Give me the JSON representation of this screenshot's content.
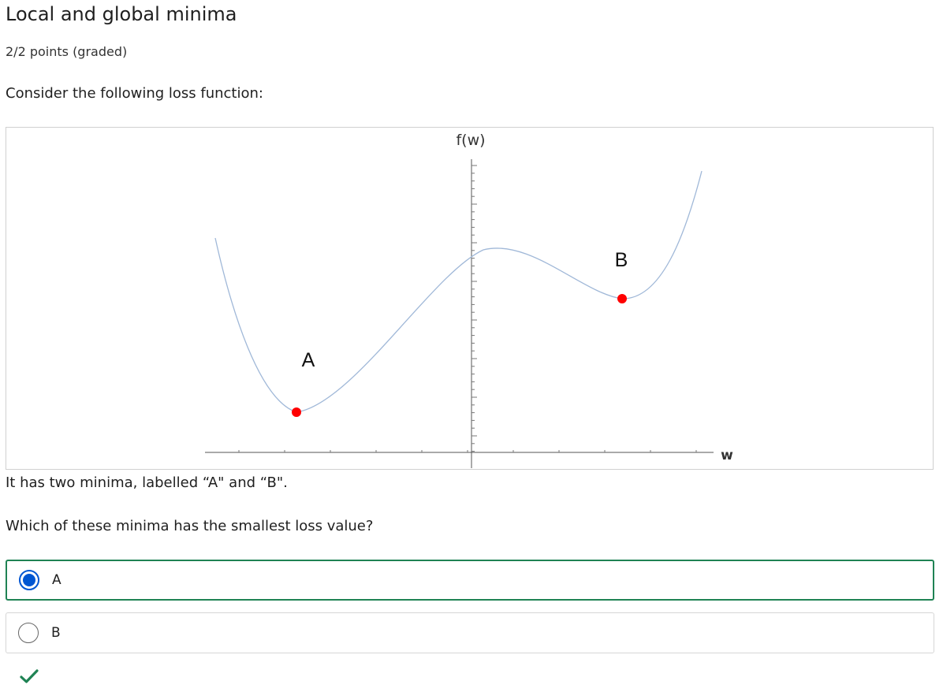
{
  "header": {
    "title": "Local and global minima",
    "points": "2/2 points (graded)"
  },
  "question": {
    "prompt": "Consider the following loss function:",
    "caption": "It has two minima, labelled “A\" and “B\".",
    "text": "Which of these minima has the smallest loss value?"
  },
  "figure": {
    "y_axis_label": "f(w)",
    "x_axis_label": "w",
    "point_labels": [
      "A",
      "B"
    ],
    "curve_color": "#a0b8d8",
    "axis_color": "#555555",
    "marker_color": "#ff0000"
  },
  "options": [
    {
      "label": "A",
      "selected": true
    },
    {
      "label": "B",
      "selected": false
    }
  ],
  "feedback": {
    "icon": "checkmark-icon",
    "color": "#1f8354"
  },
  "colors": {
    "selected_border": "#1f8354",
    "radio_selected": "#0056d2"
  }
}
